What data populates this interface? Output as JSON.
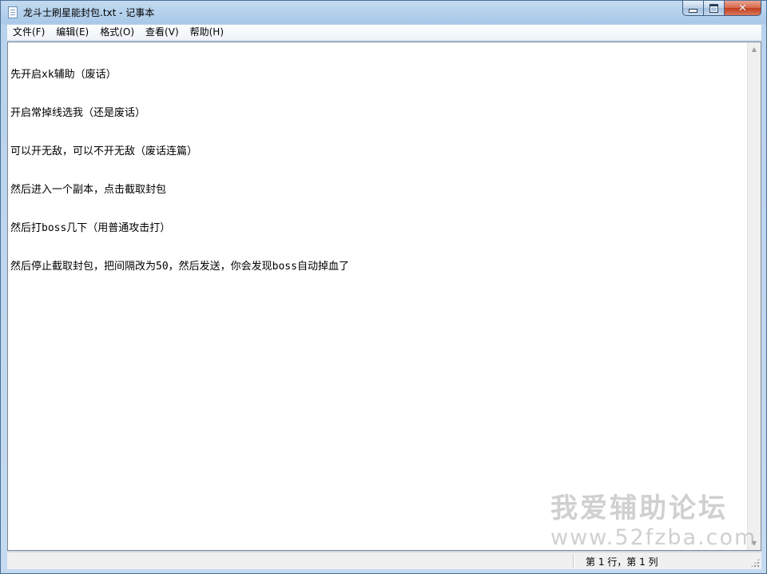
{
  "window": {
    "title": "龙斗士刷星能封包.txt - 记事本",
    "icon": "notepad-icon"
  },
  "caption_buttons": {
    "minimize": "minimize-icon",
    "maximize": "maximize-icon",
    "close": "close-icon",
    "close_color": "#c8472a"
  },
  "menu": {
    "items": [
      {
        "label": "文件(F)"
      },
      {
        "label": "编辑(E)"
      },
      {
        "label": "格式(O)"
      },
      {
        "label": "查看(V)"
      },
      {
        "label": "帮助(H)"
      }
    ]
  },
  "editor": {
    "lines": [
      "先开启xk辅助（废话）",
      "开启常掉线选我（还是废话）",
      "可以开无敌，可以不开无敌（废话连篇）",
      "然后进入一个副本，点击截取封包",
      "然后打boss几下（用普通攻击打）",
      "然后停止截取封包，把间隔改为50，然后发送，你会发现boss自动掉血了"
    ]
  },
  "watermark": {
    "title": "我爱辅助论坛",
    "url": "www.52fzba.com"
  },
  "status": {
    "position": "第 1 行，第 1 列"
  }
}
